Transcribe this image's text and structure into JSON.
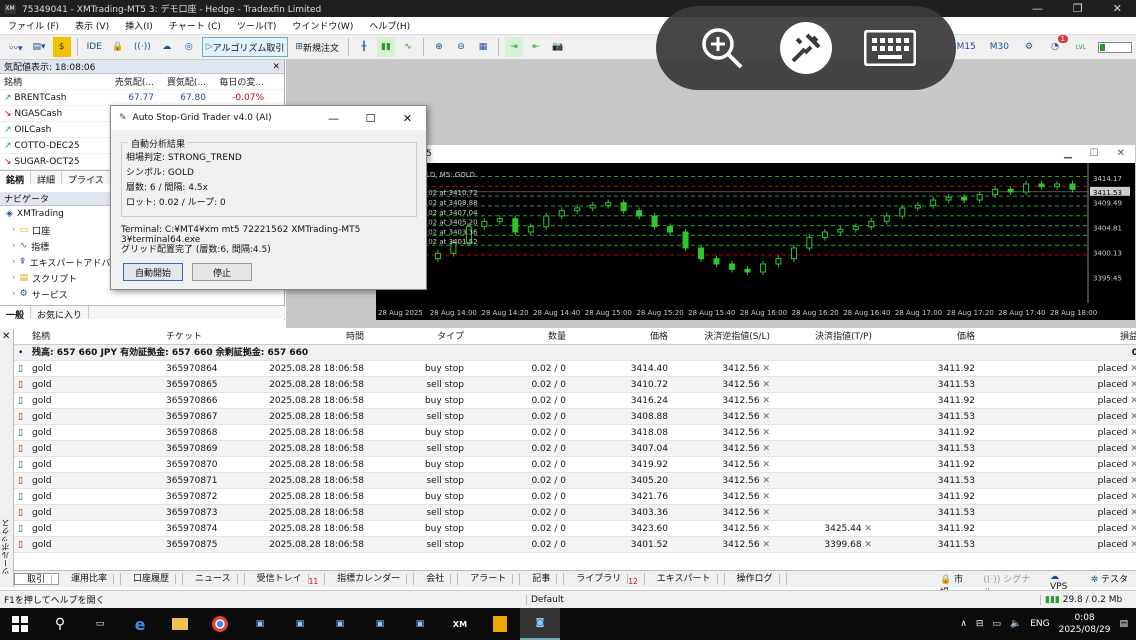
{
  "titlebar": {
    "title": "75349041 - XMTrading-MT5 3: デモ口座 - Hedge - Tradexfin Limited"
  },
  "menu": [
    "ファイル (F)",
    "表示 (V)",
    "挿入(I)",
    "チャート (C)",
    "ツール(T)",
    "ウインドウ(W)",
    "ヘルプ(H)"
  ],
  "toolbar": {
    "ide": "IDE",
    "algo": "アルゴリズム取引",
    "neworder": "新規注文",
    "m15": "M15",
    "m30": "M30",
    "notif_count": "1",
    "lvl": "LVL"
  },
  "quotes": {
    "title": "気配値表示: 18:08:06",
    "headers": [
      "銘柄",
      "売気配(...",
      "買気配(...",
      "毎日の変..."
    ],
    "rows": [
      {
        "symbol": "BRENTCash",
        "bid": "67.77",
        "ask": "67.80",
        "chg": "-0.07%",
        "dir": "up"
      },
      {
        "symbol": "NGASCash",
        "bid": "",
        "ask": "",
        "chg": "",
        "dir": "down"
      },
      {
        "symbol": "OILCash",
        "bid": "",
        "ask": "",
        "chg": "",
        "dir": "up"
      },
      {
        "symbol": "COTTO-DEC25",
        "bid": "",
        "ask": "",
        "chg": "",
        "dir": "up"
      },
      {
        "symbol": "SUGAR-OCT25",
        "bid": "",
        "ask": "",
        "chg": "",
        "dir": "down"
      }
    ],
    "tabs": [
      "銘柄",
      "詳細",
      "プライス"
    ]
  },
  "navigator": {
    "title": "ナビゲータ",
    "items": [
      "XMTrading",
      "口座",
      "指標",
      "エキスパートアドバイ...",
      "スクリプト",
      "サービス"
    ],
    "tabs": [
      "一般",
      "お気に入り"
    ]
  },
  "dialog": {
    "title": "Auto Stop-Grid Trader v4.0 (AI)",
    "legend": "自動分析結果",
    "lines": [
      "相場判定: STRONG_TREND",
      "シンボル: GOLD",
      "層数: 6 / 間隔: 4.5x",
      "ロット: 0.02 / ループ: 0"
    ],
    "terminal": "Terminal: C:¥MT4¥xm mt5 72221562 XMTrading-MT5 3¥terminal64.exe",
    "status": "グリッド配置完了 (層数:6, 間隔:4.5)",
    "start": "自動開始",
    "stop": "停止"
  },
  "chart": {
    "title": "5",
    "label": "LD, M5: GOLD",
    "price_labels": [
      "3414.17",
      "3411.53",
      "3409.49",
      "3404.81",
      "3400.13",
      "3395.45"
    ],
    "times": [
      "28 Aug 2025",
      "28 Aug 14:00",
      "28 Aug 14:20",
      "28 Aug 14:40",
      "28 Aug 15:00",
      "28 Aug 15:20",
      "28 Aug 15:40",
      "28 Aug 16:00",
      "28 Aug 16:20",
      "28 Aug 16:40",
      "28 Aug 17:00",
      "28 Aug 17:20",
      "28 Aug 17:40",
      "28 Aug 18:00"
    ],
    "order_labels": [
      ".02 at 3410.72",
      ".02 at 3408.88",
      ".02 at 3407.04",
      ".02 at 3405.20",
      ".02 at 3403.36",
      ".02 at 3401.52"
    ]
  },
  "trade": {
    "headers": [
      "銘柄",
      "チケット",
      "時間",
      "タイプ",
      "数量",
      "価格",
      "決済逆指値(S/L)",
      "決済指値(T/P)",
      "価格",
      "損益"
    ],
    "balance": "残高: 657 660 JPY  有効証拠金: 657 660  余剰証拠金: 657 660",
    "balance_pl": "0",
    "rows": [
      {
        "sym": "gold",
        "ticket": "365970864",
        "time": "2025.08.28 18:06:58",
        "type": "buy stop",
        "vol": "0.02 / 0",
        "price": "3414.40",
        "sl": "3412.56",
        "tp": "",
        "cur": "3411.92",
        "pl": "placed"
      },
      {
        "sym": "gold",
        "ticket": "365970865",
        "time": "2025.08.28 18:06:58",
        "type": "sell stop",
        "vol": "0.02 / 0",
        "price": "3410.72",
        "sl": "3412.56",
        "tp": "",
        "cur": "3411.53",
        "pl": "placed"
      },
      {
        "sym": "gold",
        "ticket": "365970866",
        "time": "2025.08.28 18:06:58",
        "type": "buy stop",
        "vol": "0.02 / 0",
        "price": "3416.24",
        "sl": "3412.56",
        "tp": "",
        "cur": "3411.92",
        "pl": "placed"
      },
      {
        "sym": "gold",
        "ticket": "365970867",
        "time": "2025.08.28 18:06:58",
        "type": "sell stop",
        "vol": "0.02 / 0",
        "price": "3408.88",
        "sl": "3412.56",
        "tp": "",
        "cur": "3411.53",
        "pl": "placed"
      },
      {
        "sym": "gold",
        "ticket": "365970868",
        "time": "2025.08.28 18:06:58",
        "type": "buy stop",
        "vol": "0.02 / 0",
        "price": "3418.08",
        "sl": "3412.56",
        "tp": "",
        "cur": "3411.92",
        "pl": "placed"
      },
      {
        "sym": "gold",
        "ticket": "365970869",
        "time": "2025.08.28 18:06:58",
        "type": "sell stop",
        "vol": "0.02 / 0",
        "price": "3407.04",
        "sl": "3412.56",
        "tp": "",
        "cur": "3411.53",
        "pl": "placed"
      },
      {
        "sym": "gold",
        "ticket": "365970870",
        "time": "2025.08.28 18:06:58",
        "type": "buy stop",
        "vol": "0.02 / 0",
        "price": "3419.92",
        "sl": "3412.56",
        "tp": "",
        "cur": "3411.92",
        "pl": "placed"
      },
      {
        "sym": "gold",
        "ticket": "365970871",
        "time": "2025.08.28 18:06:58",
        "type": "sell stop",
        "vol": "0.02 / 0",
        "price": "3405.20",
        "sl": "3412.56",
        "tp": "",
        "cur": "3411.53",
        "pl": "placed"
      },
      {
        "sym": "gold",
        "ticket": "365970872",
        "time": "2025.08.28 18:06:58",
        "type": "buy stop",
        "vol": "0.02 / 0",
        "price": "3421.76",
        "sl": "3412.56",
        "tp": "",
        "cur": "3411.92",
        "pl": "placed"
      },
      {
        "sym": "gold",
        "ticket": "365970873",
        "time": "2025.08.28 18:06:58",
        "type": "sell stop",
        "vol": "0.02 / 0",
        "price": "3403.36",
        "sl": "3412.56",
        "tp": "",
        "cur": "3411.53",
        "pl": "placed"
      },
      {
        "sym": "gold",
        "ticket": "365970874",
        "time": "2025.08.28 18:06:58",
        "type": "buy stop",
        "vol": "0.02 / 0",
        "price": "3423.60",
        "sl": "3412.56",
        "tp": "3425.44",
        "cur": "3411.92",
        "pl": "placed"
      },
      {
        "sym": "gold",
        "ticket": "365970875",
        "time": "2025.08.28 18:06:58",
        "type": "sell stop",
        "vol": "0.02 / 0",
        "price": "3401.52",
        "sl": "3412.56",
        "tp": "3399.68",
        "cur": "3411.53",
        "pl": "placed"
      }
    ]
  },
  "side_label": "ツールボックス",
  "bottom_tabs": [
    "取引",
    "運用比率",
    "口座履歴",
    "ニュース",
    "受信トレイ",
    "指標カレンダー",
    "会社",
    "アラート",
    "記事",
    "ライブラリ",
    "エキスパート",
    "操作ログ"
  ],
  "inbox_count": "11",
  "library_count": "12",
  "bottom_right": {
    "market": "市場",
    "signal": "シグナル",
    "vps": "VPS",
    "tester": "テスター"
  },
  "status": {
    "help": "F1を押してヘルプを開く",
    "profile": "Default",
    "net": "29.8 / 0.2 Mb"
  },
  "taskbar": {
    "lang": "ENG",
    "time": "0:08",
    "date": "2025/08/29"
  }
}
